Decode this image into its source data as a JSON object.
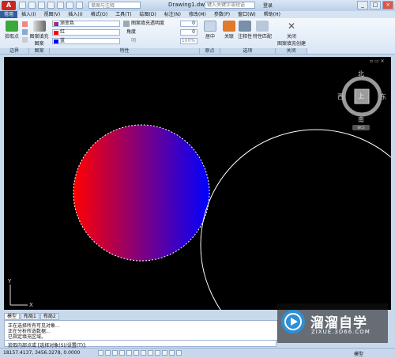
{
  "window": {
    "app_menu_label": "A",
    "workspace_text": "草图与注释",
    "document_title": "Drawing1.dwg",
    "search_placeholder": "键入关键字或短语",
    "login_label": "登录",
    "controls": [
      "_",
      "□",
      "×"
    ]
  },
  "menu": [
    "常用",
    "插入(I)",
    "视图(V)",
    "插入(I)",
    "格式(O)",
    "工具(T)",
    "绘图(D)",
    "标注(N)",
    "修改(M)",
    "参数(P)",
    "窗口(W)",
    "帮助(H)"
  ],
  "ribbon": {
    "boundary": {
      "pick_label": "拾取点",
      "footer": "边界"
    },
    "pattern": {
      "label_line1": "图案填充",
      "label_line2": "图案",
      "footer": "图案"
    },
    "properties": {
      "type_value": "渐变色",
      "color1_value": "红",
      "color2_value": "蓝",
      "transparency_label": "图案填充透明度",
      "transparency_value": "0",
      "angle_label": "角度",
      "angle_value": "0",
      "tint_label": "明",
      "tint_value": "100%",
      "footer": "特性"
    },
    "origin": {
      "center_label": "居中",
      "footer": "原点"
    },
    "options": {
      "associative_label": "关联",
      "annotative_label": "注释性",
      "match_label": "特性匹配",
      "footer": "选项"
    },
    "close": {
      "label_line1": "关闭",
      "label_line2": "图案填充创建",
      "footer": "关闭"
    }
  },
  "colors": {
    "gradient_start": "#ff0000",
    "gradient_end": "#0000ff",
    "viewport_bg": "#000000",
    "circle_stroke": "#ffffff"
  },
  "viewcube": {
    "north": "北",
    "south": "南",
    "east": "东",
    "west": "西",
    "top": "上",
    "wcs": "WCS"
  },
  "viewport_controls": "▫ ▭ ×",
  "ucs": {
    "x": "X",
    "y": "Y"
  },
  "layout_tabs": [
    "模型",
    "布局1",
    "布局2"
  ],
  "command_history": [
    "正在选择所有可见对象...",
    "正在分析所选数据...",
    "已指定填充区域。"
  ],
  "command_prompt": "拾取内部点或 [选择对象(S)/设置(T)]:",
  "status": {
    "coordinates": "18157.4137, 3456.3278, 0.0000",
    "model_label": "模型"
  },
  "watermark": {
    "title": "溜溜自学",
    "subtitle": "ZIXUE.3D66.COM"
  }
}
